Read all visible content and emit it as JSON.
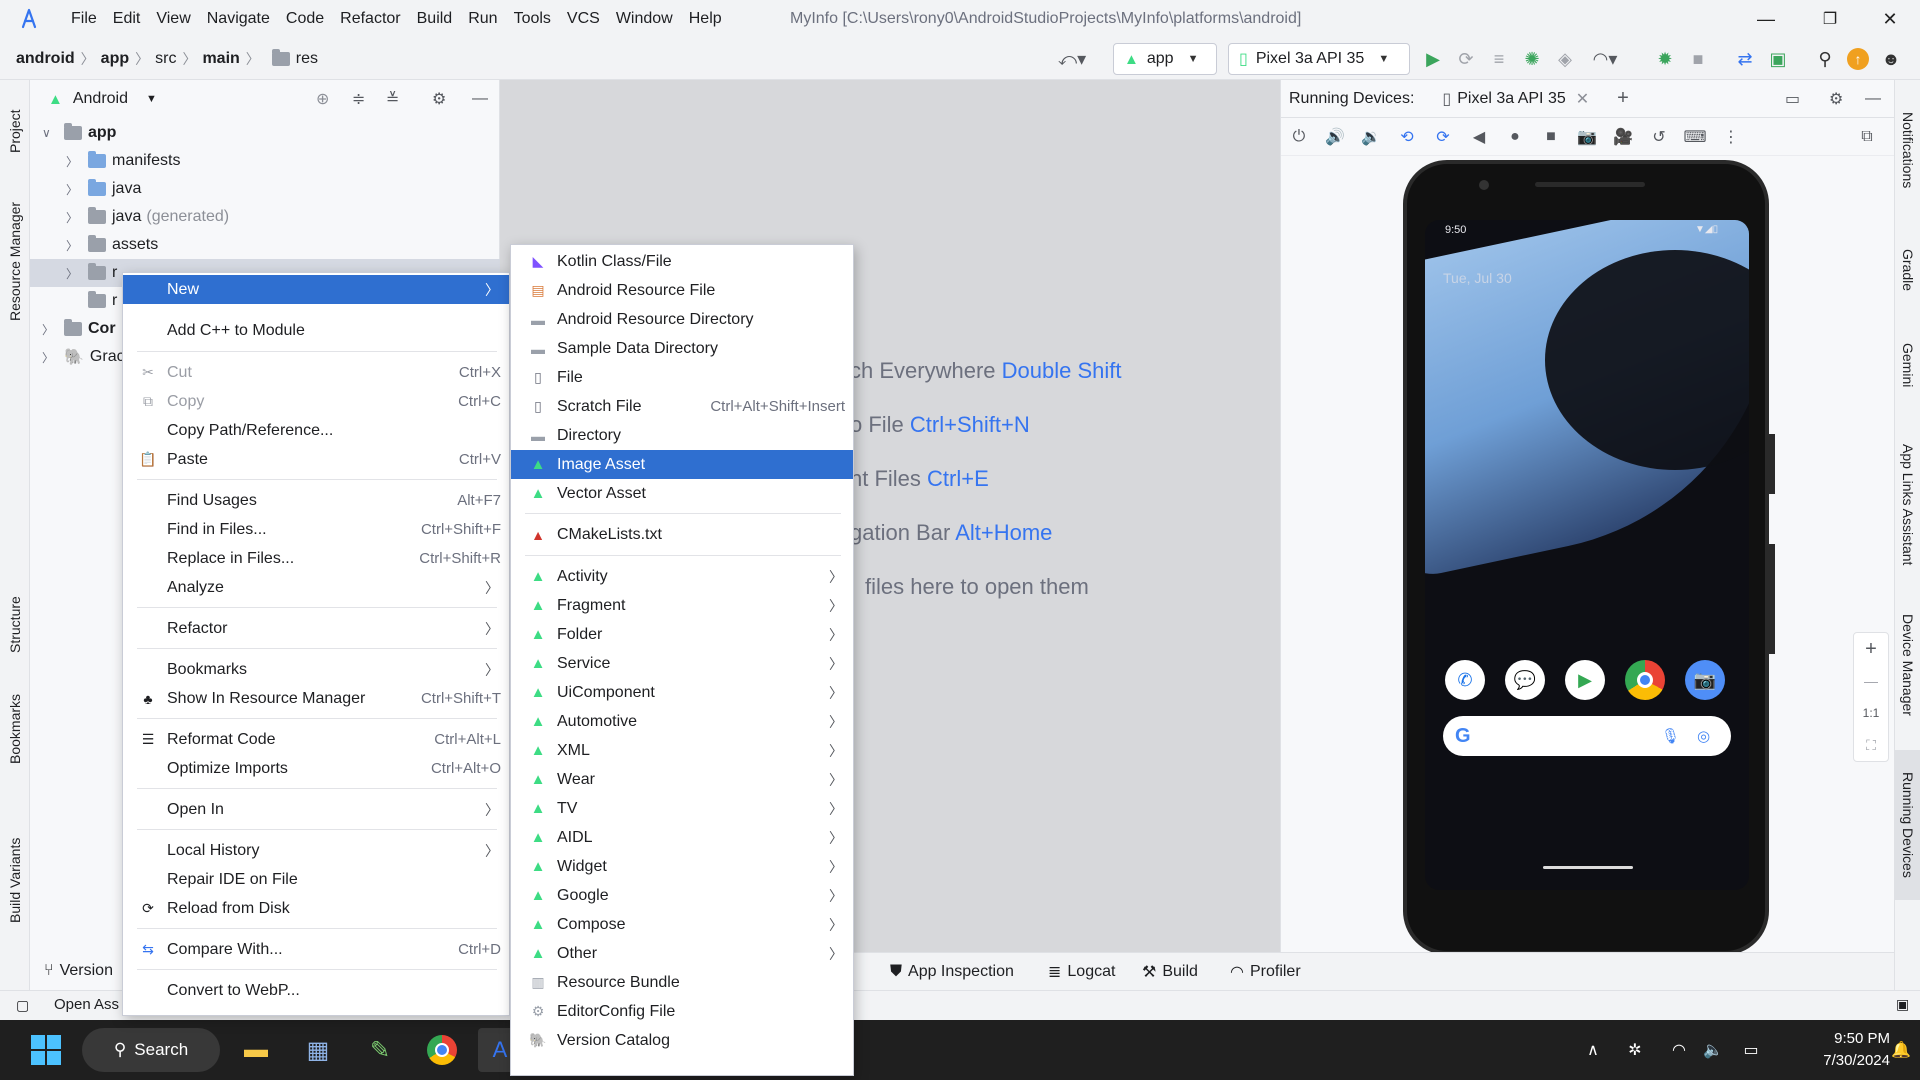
{
  "title_bar": {
    "menus": [
      "File",
      "Edit",
      "View",
      "Navigate",
      "Code",
      "Refactor",
      "Build",
      "Run",
      "Tools",
      "VCS",
      "Window",
      "Help"
    ],
    "window_title": "MyInfo [C:\\Users\\rony0\\AndroidStudioProjects\\MyInfo\\platforms\\android]",
    "minimize": "—",
    "restore": "❐",
    "close": "✕"
  },
  "navbar": {
    "breadcrumb": [
      "android",
      "app",
      "src",
      "main",
      "res"
    ],
    "run_config": "app",
    "device": "Pixel 3a API 35"
  },
  "left_strip": {
    "tabs": [
      "Project",
      "Resource Manager",
      "Structure",
      "Bookmarks",
      "Build Variants"
    ]
  },
  "project_panel": {
    "view": "Android",
    "tree": [
      {
        "label": "app",
        "bold": true
      },
      {
        "label": "manifests"
      },
      {
        "label": "java"
      },
      {
        "label": "java",
        "suffix": "(generated)"
      },
      {
        "label": "assets"
      },
      {
        "label": "r"
      },
      {
        "label": "r"
      },
      {
        "label": "Cor"
      },
      {
        "label": "Grac"
      }
    ]
  },
  "editor_hints": [
    {
      "text": "ch Everywhere",
      "key": "Double Shift"
    },
    {
      "text": "o File",
      "key": "Ctrl+Shift+N"
    },
    {
      "text": "nt Files",
      "key": "Ctrl+E"
    },
    {
      "text": "gation Bar",
      "key": "Alt+Home"
    },
    {
      "text": "files here to open them",
      "key": ""
    }
  ],
  "running_devices": {
    "label": "Running Devices:",
    "tab": "Pixel 3a API 35",
    "phone": {
      "status_time": "9:50",
      "date": "Tue, Jul 30",
      "search_logo": "G"
    },
    "zoom": {
      "plus": "+",
      "minus": "—",
      "one_to_one": "1:1"
    }
  },
  "right_strip": {
    "tabs": [
      "Notifications",
      "Gradle",
      "Gemini",
      "App Links Assistant",
      "Device Manager",
      "Running Devices"
    ]
  },
  "bottom_tools": {
    "version": "Version",
    "app_inspection": "App Inspection",
    "logcat": "Logcat",
    "build": "Build",
    "profiler": "Profiler"
  },
  "status_bar": {
    "text": "Open Ass"
  },
  "context_menu": {
    "items": [
      {
        "label": "New",
        "sub": true,
        "highlight": true
      },
      {
        "label": "Add C++ to Module"
      },
      {
        "label": "Cut",
        "shortcut": "Ctrl+X",
        "disabled": true
      },
      {
        "label": "Copy",
        "shortcut": "Ctrl+C",
        "disabled": true
      },
      {
        "label": "Copy Path/Reference..."
      },
      {
        "label": "Paste",
        "shortcut": "Ctrl+V"
      },
      {
        "label": "Find Usages",
        "shortcut": "Alt+F7"
      },
      {
        "label": "Find in Files...",
        "shortcut": "Ctrl+Shift+F"
      },
      {
        "label": "Replace in Files...",
        "shortcut": "Ctrl+Shift+R"
      },
      {
        "label": "Analyze",
        "sub": true
      },
      {
        "label": "Refactor",
        "sub": true
      },
      {
        "label": "Bookmarks",
        "sub": true
      },
      {
        "label": "Show In Resource Manager",
        "shortcut": "Ctrl+Shift+T"
      },
      {
        "label": "Reformat Code",
        "shortcut": "Ctrl+Alt+L"
      },
      {
        "label": "Optimize Imports",
        "shortcut": "Ctrl+Alt+O"
      },
      {
        "label": "Open In",
        "sub": true
      },
      {
        "label": "Local History",
        "sub": true
      },
      {
        "label": "Repair IDE on File"
      },
      {
        "label": "Reload from Disk"
      },
      {
        "label": "Compare With...",
        "shortcut": "Ctrl+D"
      },
      {
        "label": "Convert to WebP..."
      }
    ]
  },
  "new_submenu": {
    "items": [
      {
        "label": "Kotlin Class/File"
      },
      {
        "label": "Android Resource File"
      },
      {
        "label": "Android Resource Directory"
      },
      {
        "label": "Sample Data Directory"
      },
      {
        "label": "File"
      },
      {
        "label": "Scratch File",
        "shortcut": "Ctrl+Alt+Shift+Insert"
      },
      {
        "label": "Directory"
      },
      {
        "label": "Image Asset",
        "highlight": true
      },
      {
        "label": "Vector Asset"
      },
      {
        "label": "CMakeLists.txt"
      },
      {
        "label": "Activity",
        "sub": true
      },
      {
        "label": "Fragment",
        "sub": true
      },
      {
        "label": "Folder",
        "sub": true
      },
      {
        "label": "Service",
        "sub": true
      },
      {
        "label": "UiComponent",
        "sub": true
      },
      {
        "label": "Automotive",
        "sub": true
      },
      {
        "label": "XML",
        "sub": true
      },
      {
        "label": "Wear",
        "sub": true
      },
      {
        "label": "TV",
        "sub": true
      },
      {
        "label": "AIDL",
        "sub": true
      },
      {
        "label": "Widget",
        "sub": true
      },
      {
        "label": "Google",
        "sub": true
      },
      {
        "label": "Compose",
        "sub": true
      },
      {
        "label": "Other",
        "sub": true
      },
      {
        "label": "Resource Bundle"
      },
      {
        "label": "EditorConfig File"
      },
      {
        "label": "Version Catalog"
      }
    ]
  },
  "taskbar": {
    "search": "Search",
    "time": "9:50 PM",
    "date": "7/30/2024"
  },
  "colors": {
    "accent": "#2f6fd0",
    "android_green": "#3ddc84",
    "link_blue": "#3574f0"
  }
}
